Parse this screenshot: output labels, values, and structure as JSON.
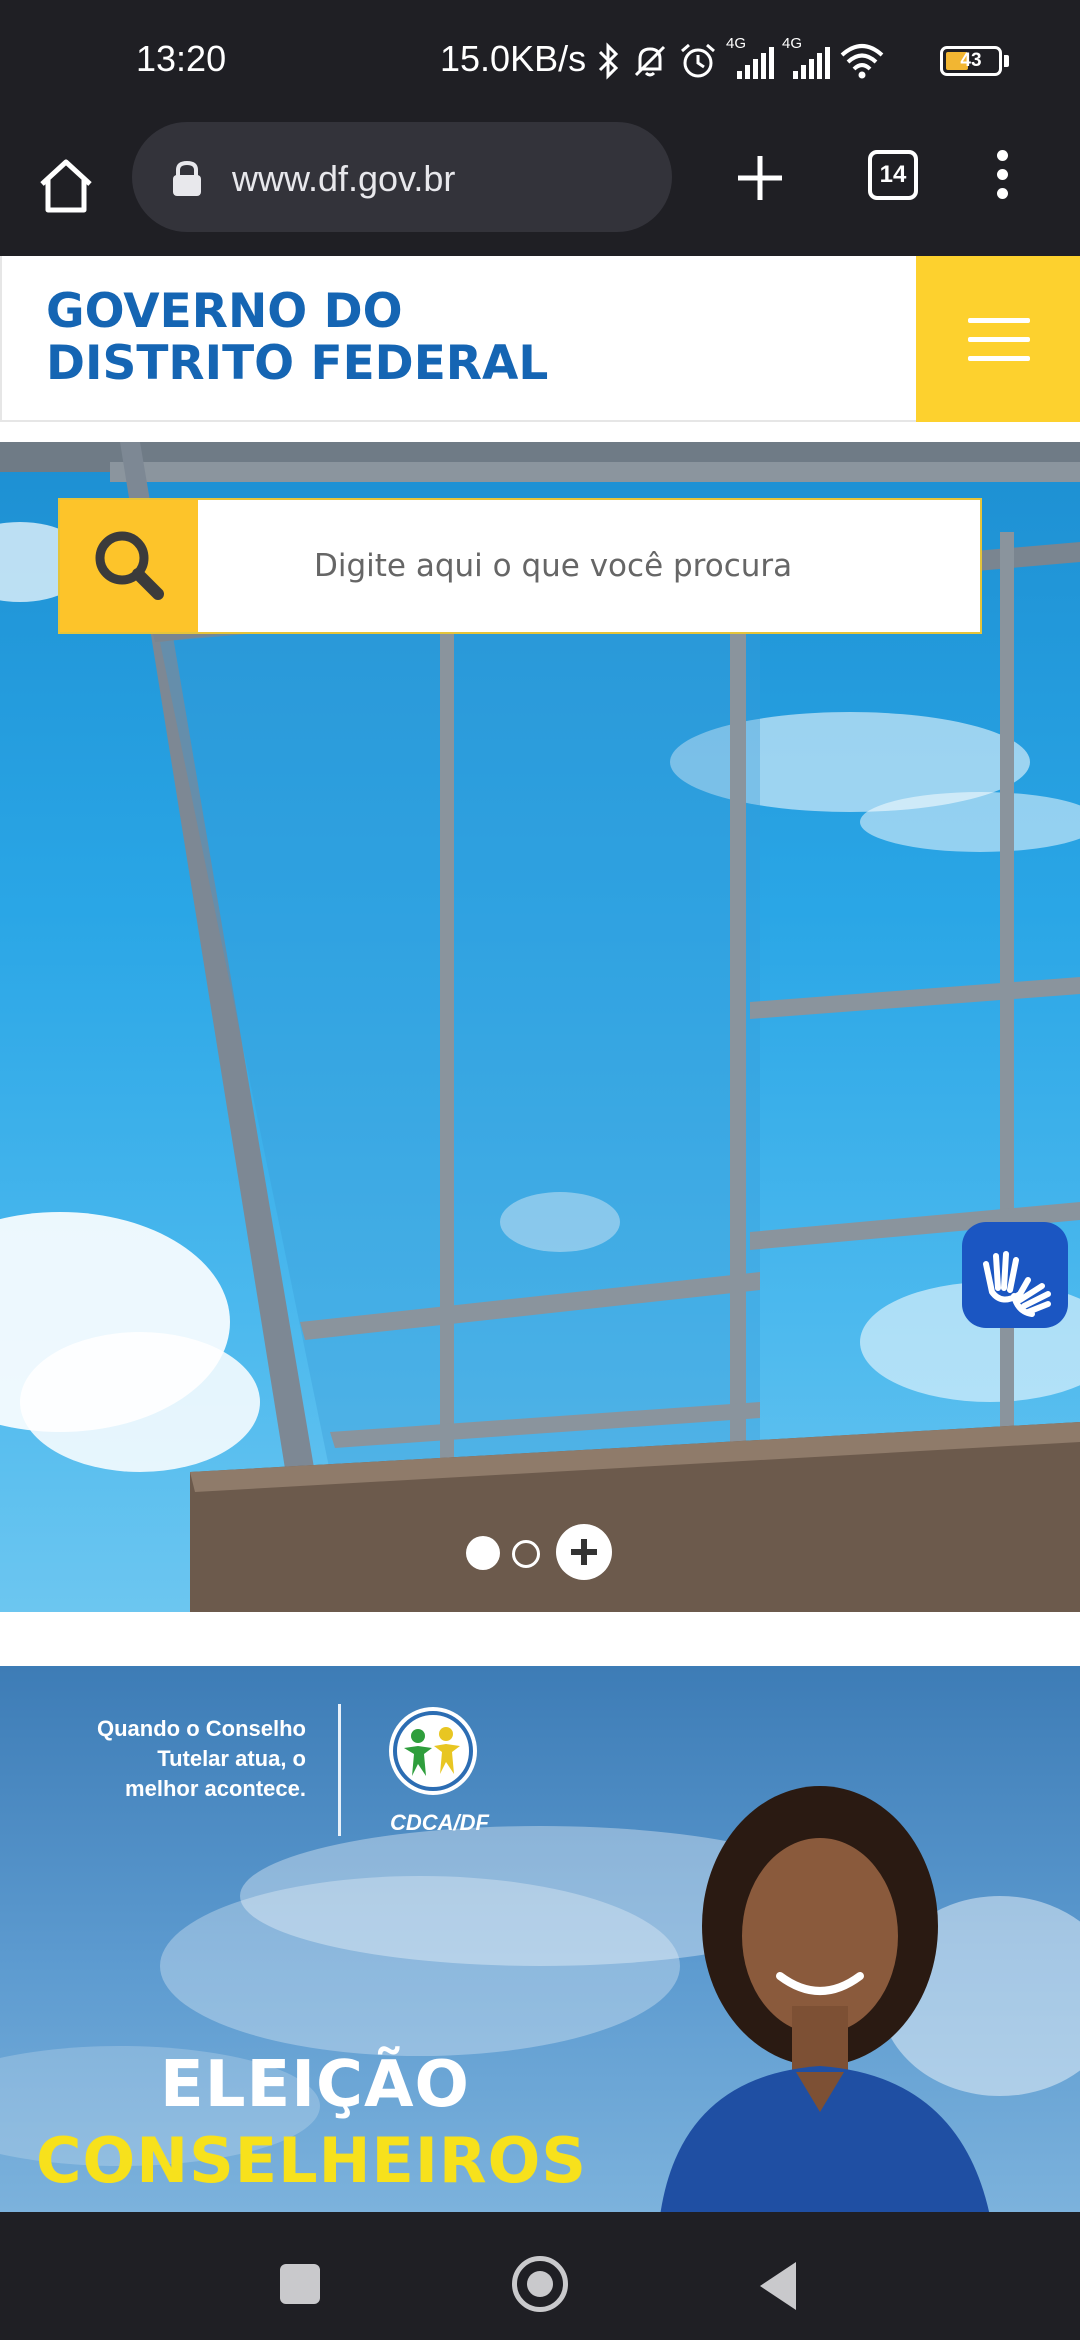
{
  "status_bar": {
    "time": "13:20",
    "net_speed": "15.0KB/s",
    "network_1": "4G",
    "network_2": "4G",
    "battery": "43",
    "icons": [
      "bluetooth-icon",
      "silent-bell-icon",
      "alarm-icon",
      "signal-icon",
      "signal-icon",
      "wifi-icon",
      "battery-icon"
    ]
  },
  "browser": {
    "url": "www.df.gov.br",
    "tab_count": "14",
    "icons": [
      "home-icon",
      "lock-icon",
      "plus-icon",
      "tabs-icon",
      "more-vert-icon"
    ]
  },
  "site": {
    "title_line1": "GOVERNO DO",
    "title_line2": "DISTRITO FEDERAL",
    "menu_icon": "hamburger-icon",
    "accent_color": "#fdd12e",
    "title_color": "#1565b3"
  },
  "hero": {
    "search_placeholder": "Digite aqui o que você procura",
    "search_icon": "search-icon",
    "libras_icon": "sign-language-icon",
    "carousel_more_icon": "plus-icon",
    "slides": 2,
    "active_slide": 1
  },
  "banner": {
    "tagline": "Quando o Conselho Tutelar atua, o melhor acontece.",
    "logo_label": "CDCA/DF",
    "heading_line1": "ELEIÇÃO",
    "heading_line2": "CONSELHEIROS",
    "heading_line2_color": "#f7e11c"
  },
  "nav_bar": {
    "icons": [
      "recents-square-icon",
      "home-circle-icon",
      "back-triangle-icon"
    ]
  }
}
